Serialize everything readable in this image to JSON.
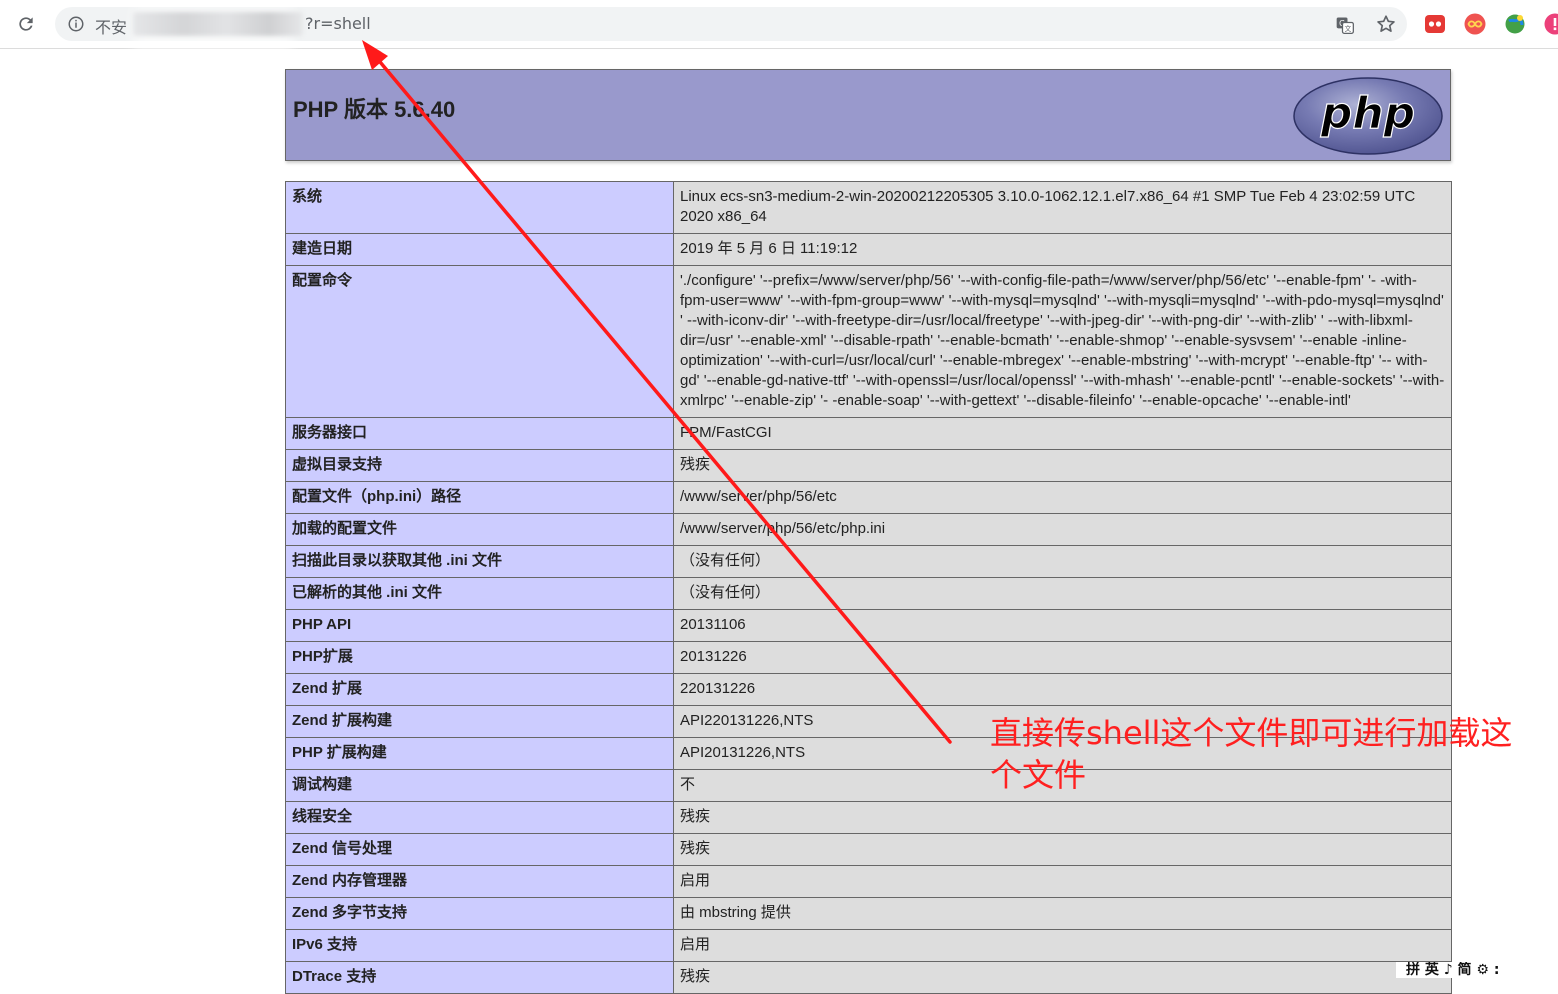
{
  "browser": {
    "security_label": "不安",
    "url_suffix": "?r=shell"
  },
  "php": {
    "title": "PHP 版本 5.6.40",
    "logo_text": "php"
  },
  "rows": [
    {
      "label": "系统",
      "value": "Linux ecs-sn3-medium-2-win-20200212205305 3.10.0-1062.12.1.el7.x86_64 #1 SMP Tue Feb 4 23:02:59 UTC 2020 x86_64"
    },
    {
      "label": "建造日期",
      "value": "2019 年 5 月 6 日 11:19:12"
    },
    {
      "label": "配置命令",
      "value": "'./configure' '--prefix=/www/server/php/56' '--with-config-file-path=/www/server/php/56/etc' '--enable-fpm' '- -with-fpm-user=www' '--with-fpm-group=www' '--with-mysql=mysqlnd' '--with-mysqli=mysqlnd' '--with-pdo-mysql=mysqlnd' ' --with-iconv-dir' '--with-freetype-dir=/usr/local/freetype' '--with-jpeg-dir' '--with-png-dir' '--with-zlib' ' --with-libxml-dir=/usr' '--enable-xml' '--disable-rpath' '--enable-bcmath' '--enable-shmop' '--enable-sysvsem' '--enable -inline-optimization' '--with-curl=/usr/local/curl' '--enable-mbregex' '--enable-mbstring' '--with-mcrypt' '--enable-ftp' '-- with-gd' '--enable-gd-native-ttf' '--with-openssl=/usr/local/openssl' '--with-mhash' '--enable-pcntl' '--enable-sockets' '--with-xmlrpc' '--enable-zip' '- -enable-soap' '--with-gettext' '--disable-fileinfo' '--enable-opcache' '--enable-intl'"
    },
    {
      "label": "服务器接口",
      "value": "FPM/FastCGI"
    },
    {
      "label": "虚拟目录支持",
      "value": "残疾"
    },
    {
      "label": "配置文件（php.ini）路径",
      "value": "/www/server/php/56/etc"
    },
    {
      "label": "加载的配置文件",
      "value": "/www/server/php/56/etc/php.ini"
    },
    {
      "label": "扫描此目录以获取其他 .ini 文件",
      "value": "（没有任何）"
    },
    {
      "label": "已解析的其他 .ini 文件",
      "value": "（没有任何）"
    },
    {
      "label": "PHP API",
      "value": "20131106"
    },
    {
      "label": "PHP扩展",
      "value": "20131226"
    },
    {
      "label": "Zend 扩展",
      "value": "220131226"
    },
    {
      "label": "Zend 扩展构建",
      "value": "API220131226,NTS"
    },
    {
      "label": "PHP 扩展构建",
      "value": "API20131226,NTS"
    },
    {
      "label": "调试构建",
      "value": "不"
    },
    {
      "label": "线程安全",
      "value": "残疾"
    },
    {
      "label": "Zend 信号处理",
      "value": "残疾"
    },
    {
      "label": "Zend 内存管理器",
      "value": "启用"
    },
    {
      "label": "Zend 多字节支持",
      "value": "由 mbstring 提供"
    },
    {
      "label": "IPv6 支持",
      "value": "启用"
    },
    {
      "label": "DTrace 支持",
      "value": "残疾"
    }
  ],
  "annotation": {
    "text": "直接传shell这个文件即可进行加载这个文件",
    "color": "#ff2020"
  },
  "corner_crumb": "拼 英 ♪ 简 ⚙ :"
}
